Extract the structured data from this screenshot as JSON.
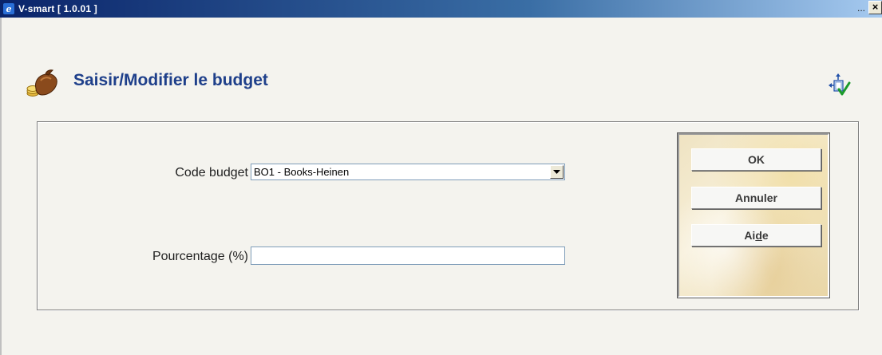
{
  "window": {
    "title": "V-smart [ 1.0.01 ]",
    "title_dots": "...",
    "close_label": "×"
  },
  "header": {
    "title": "Saisir/Modifier le budget",
    "icon": "money-bag-icon",
    "tool_icon": "adjust-check-icon"
  },
  "form": {
    "code_budget_label": "Code budget",
    "code_budget_value": "BO1 - Books-Heinen",
    "percentage_label": "Pourcentage (%)",
    "percentage_value": ""
  },
  "buttons": {
    "ok": "OK",
    "cancel": "Annuler",
    "help_prefix": "Ai",
    "help_underlined": "d",
    "help_suffix": "e"
  },
  "colors": {
    "title_color": "#1e3f8a",
    "titlebar_start": "#0a246a",
    "titlebar_end": "#a6caf0"
  }
}
